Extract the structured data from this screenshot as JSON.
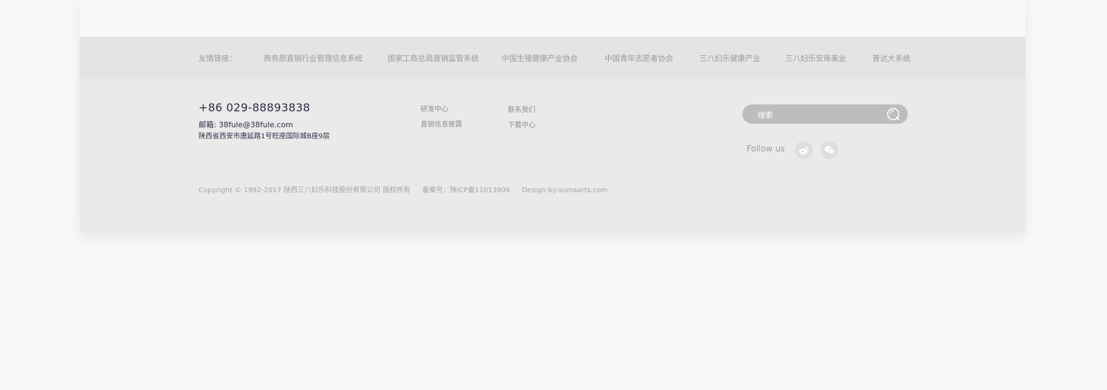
{
  "friend_links": {
    "label": "友情链接：",
    "items": [
      "商务部直销行业管理信息系统",
      "国家工商总局直销监管系统",
      "中国生殖健康产业协会",
      "中国青年志愿者协会",
      "三八妇乐健康产业",
      "三八妇乐安琢美业",
      "普达大系统"
    ]
  },
  "contact": {
    "phone": "+86 029-88893838",
    "email": "邮箱: 38fule@38fule.com",
    "address": "陕西省西安市唐延路1号旺座国际城B座9层"
  },
  "footer_nav": {
    "col1": [
      "研发中心",
      "直销信息披露"
    ],
    "col2": [
      "联系我们",
      "下载中心"
    ]
  },
  "search": {
    "placeholder": "搜索"
  },
  "social": {
    "follow_label": "Follow us",
    "icons": [
      "weibo-icon",
      "wechat-icon"
    ]
  },
  "copyright": {
    "text": "Copyright © 1992-2017 陕西三八妇乐科技股份有限公司 版权所有",
    "icp": "备案号：陕ICP备11013909",
    "design": "Design by:sumaarts.com"
  },
  "colors": {
    "page_bg": "#f8f8f9",
    "links_bar_bg": "#e4e4e4",
    "footer_bg": "#eaeaea",
    "dark_text": "#2c2c45",
    "search_bg": "#bdbdbd"
  }
}
